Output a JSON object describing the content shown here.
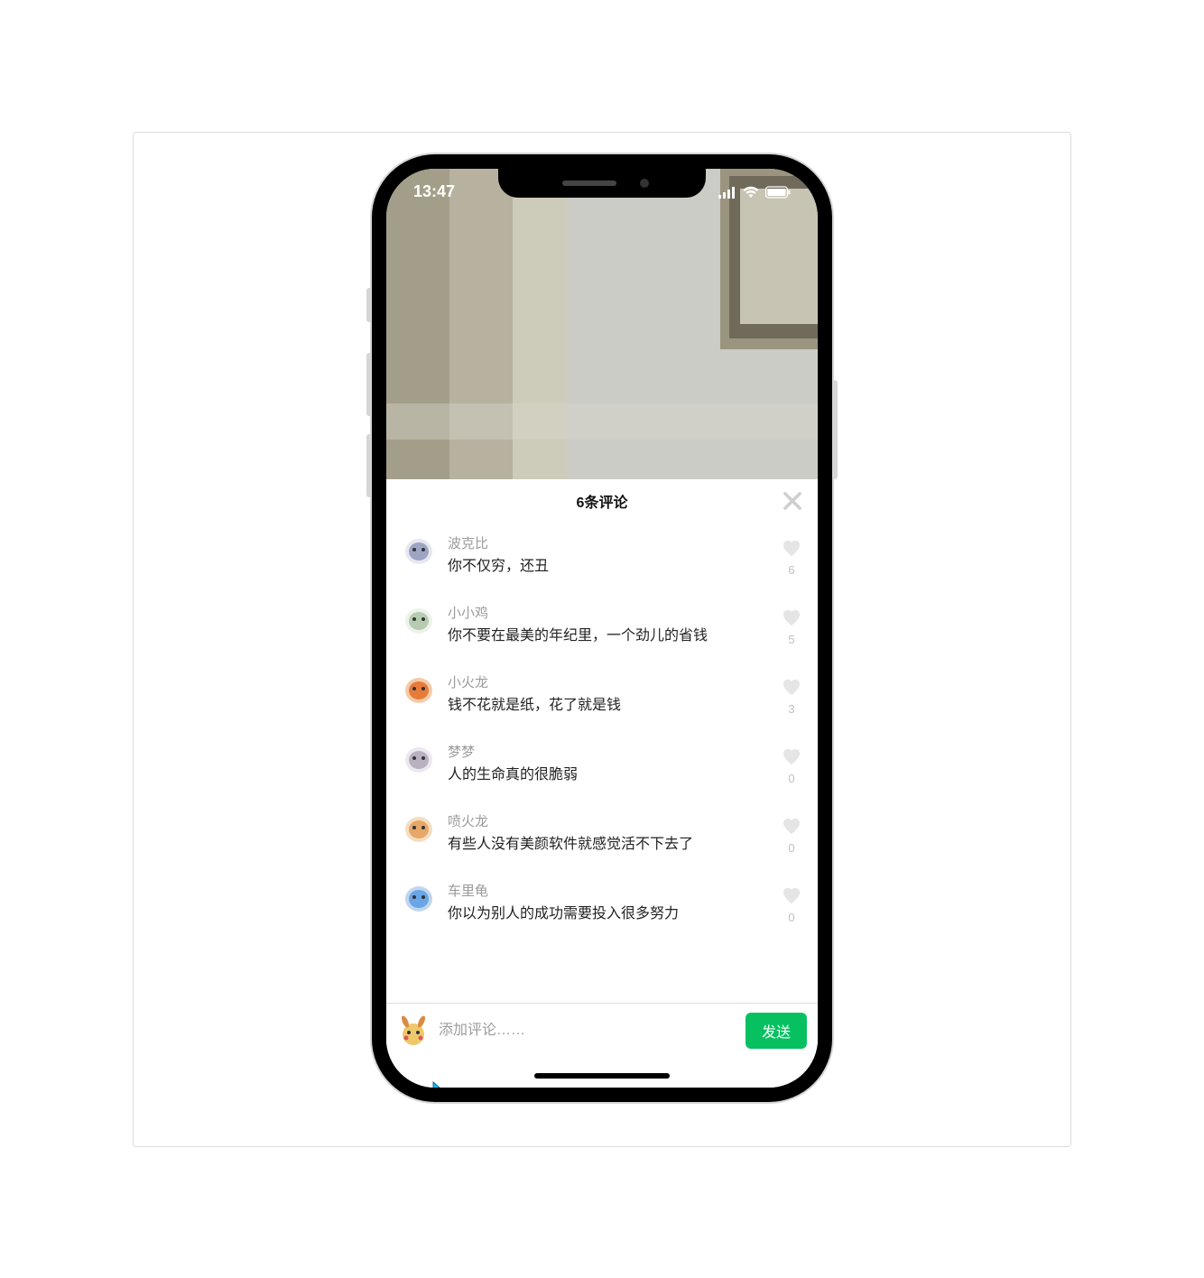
{
  "status": {
    "time": "13:47",
    "signal_icon": "signal-icon",
    "wifi_icon": "wifi-icon",
    "battery_icon": "battery-icon"
  },
  "panel": {
    "title": "6条评论",
    "close_label": "close"
  },
  "comments": [
    {
      "name": "波克比",
      "text": "你不仅穷，还丑",
      "likes": "6",
      "avatar_color1": "#9ea4c4",
      "avatar_color2": "#e6e8f0"
    },
    {
      "name": "小小鸡",
      "text": "你不要在最美的年纪里，一个劲儿的省钱",
      "likes": "5",
      "avatar_color1": "#b7cbb0",
      "avatar_color2": "#eef2ea"
    },
    {
      "name": "小火龙",
      "text": "钱不花就是纸，花了就是钱",
      "likes": "3",
      "avatar_color1": "#e67b3a",
      "avatar_color2": "#f4cba8"
    },
    {
      "name": "梦梦",
      "text": "人的生命真的很脆弱",
      "likes": "0",
      "avatar_color1": "#b9b0c0",
      "avatar_color2": "#ece7f0"
    },
    {
      "name": "喷火龙",
      "text": "有些人没有美颜软件就感觉活不下去了",
      "likes": "0",
      "avatar_color1": "#e6a76a",
      "avatar_color2": "#f4dec0"
    },
    {
      "name": "车里龟",
      "text": "你以为别人的成功需要投入很多努力",
      "likes": "0",
      "avatar_color1": "#6aa5e6",
      "avatar_color2": "#c1d6ed"
    }
  ],
  "input": {
    "placeholder": "添加评论……",
    "send_label": "发送",
    "avatar_color1": "#eec96b",
    "avatar_color2": "#d88c3f"
  }
}
